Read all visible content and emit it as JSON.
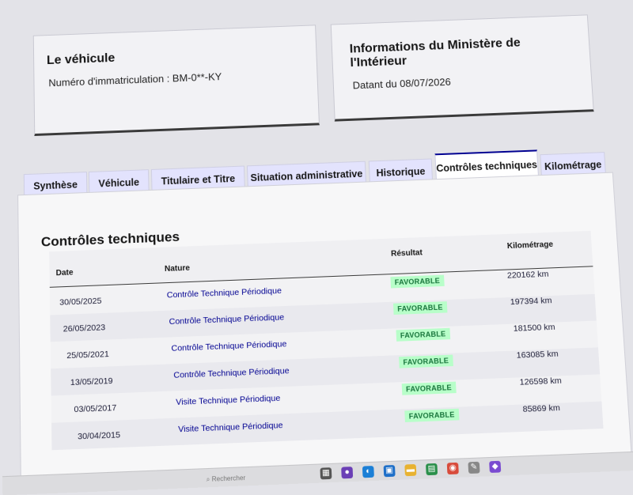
{
  "vehicle_card": {
    "title": "Le véhicule",
    "registration_label": "Numéro d'immatriculation : BM-0**-KY"
  },
  "ministry_card": {
    "title": "Informations du Ministère de l'Intérieur",
    "date_label": "Datant du 08/07/2026"
  },
  "tabs": [
    {
      "label": "Synthèse",
      "active": false
    },
    {
      "label": "Véhicule",
      "active": false
    },
    {
      "label": "Titulaire et Titre",
      "active": false
    },
    {
      "label": "Situation administrative",
      "active": false
    },
    {
      "label": "Historique",
      "active": false
    },
    {
      "label": "Contrôles techniques",
      "active": true
    },
    {
      "label": "Kilométrage",
      "active": false
    }
  ],
  "section": {
    "title": "Contrôles techniques",
    "columns": {
      "date": "Date",
      "nature": "Nature",
      "resultat": "Résultat",
      "kilometrage": "Kilométrage"
    },
    "rows": [
      {
        "date": "30/05/2025",
        "nature": "Contrôle Technique Périodique",
        "resultat": "FAVORABLE",
        "km": "220162 km"
      },
      {
        "date": "26/05/2023",
        "nature": "Contrôle Technique Périodique",
        "resultat": "FAVORABLE",
        "km": "197394 km"
      },
      {
        "date": "25/05/2021",
        "nature": "Contrôle Technique Périodique",
        "resultat": "FAVORABLE",
        "km": "181500 km"
      },
      {
        "date": "13/05/2019",
        "nature": "Contrôle Technique Périodique",
        "resultat": "FAVORABLE",
        "km": "163085 km"
      },
      {
        "date": "03/05/2017",
        "nature": "Visite Technique Périodique",
        "resultat": "FAVORABLE",
        "km": "126598 km"
      },
      {
        "date": "30/04/2015",
        "nature": "Visite Technique Périodique",
        "resultat": "FAVORABLE",
        "km": "85869 km"
      }
    ]
  },
  "taskbar": {
    "search_label": "Rechercher"
  },
  "colors": {
    "accent": "#000091",
    "badge_bg": "#b8fec9",
    "badge_text": "#18753c"
  }
}
